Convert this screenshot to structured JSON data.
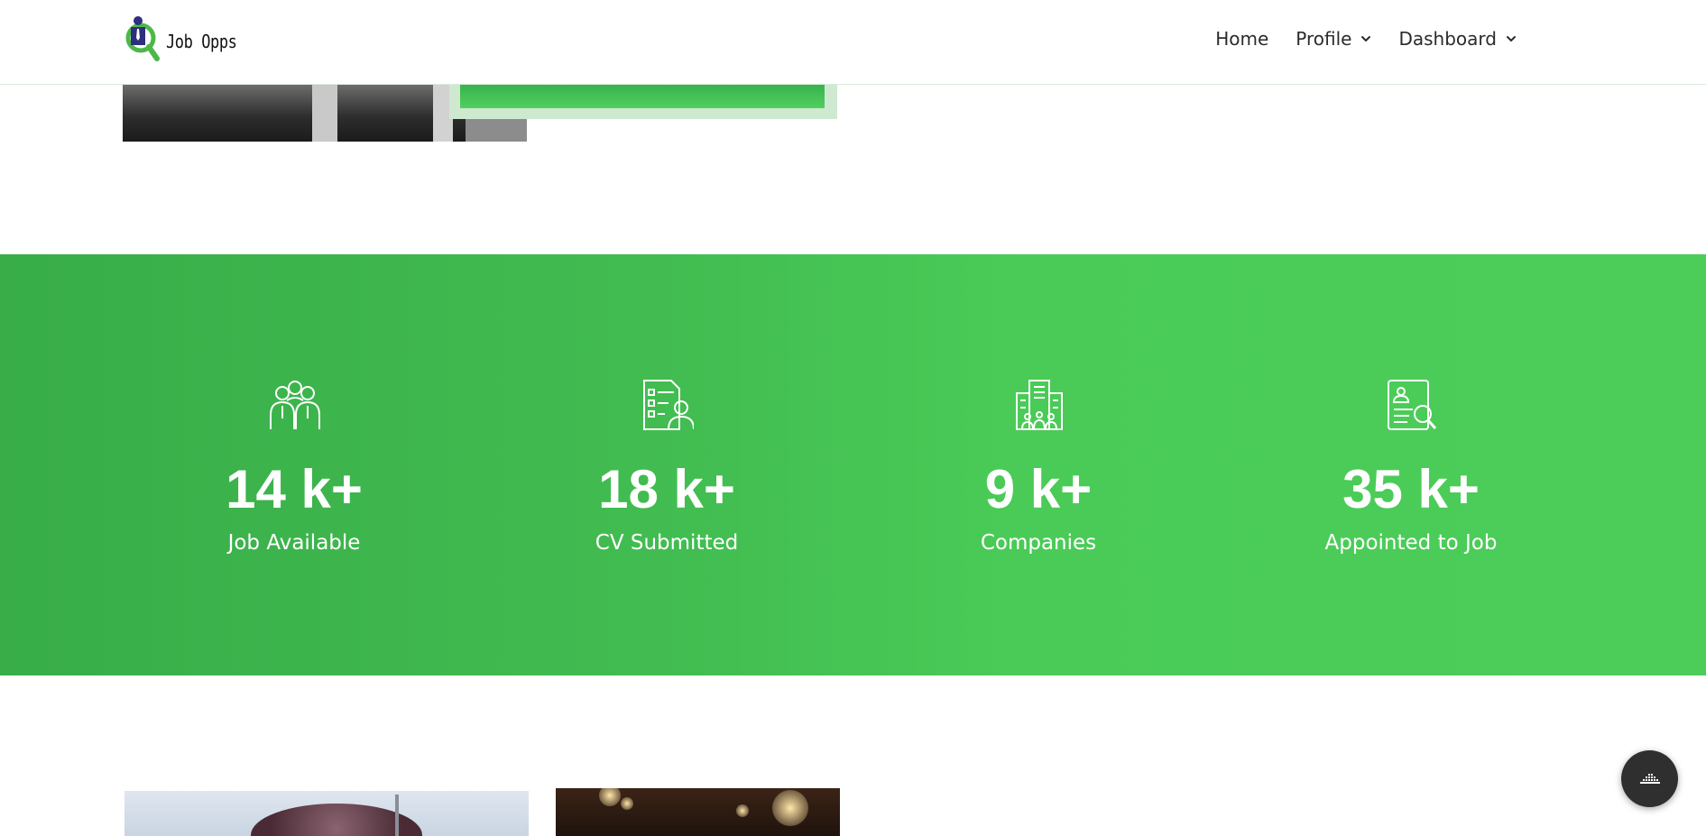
{
  "header": {
    "logo_text": "Job Opps",
    "nav": [
      {
        "label": "Home",
        "has_dropdown": false
      },
      {
        "label": "Profile",
        "has_dropdown": true
      },
      {
        "label": "Dashboard",
        "has_dropdown": true
      }
    ]
  },
  "stats": [
    {
      "icon": "team-icon",
      "value": "14 k+",
      "label": "Job Available"
    },
    {
      "icon": "cv-document-icon",
      "value": "18 k+",
      "label": "CV Submitted"
    },
    {
      "icon": "company-building-icon",
      "value": "9 k+",
      "label": "Companies"
    },
    {
      "icon": "resume-search-icon",
      "value": "35 k+",
      "label": "Appointed to Job"
    }
  ],
  "colors": {
    "brand_green": "#4acb57",
    "brand_green_dark": "#38ad48",
    "logo_blue": "#2d2f7f",
    "fab_bg": "#2f2f2f"
  },
  "fab": {
    "icon": "chat-icon"
  }
}
